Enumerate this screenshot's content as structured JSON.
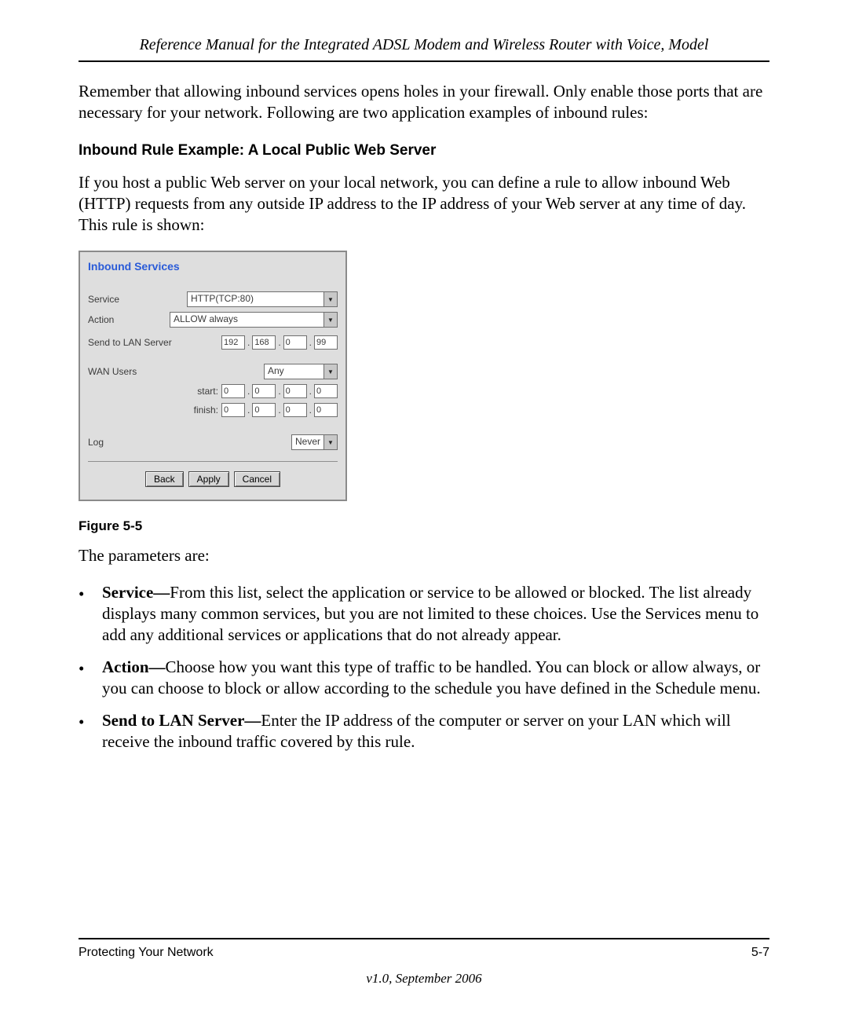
{
  "header": {
    "title": "Reference Manual for the Integrated ADSL Modem and Wireless Router with Voice, Model"
  },
  "intro": "Remember that allowing inbound services opens holes in your firewall. Only enable those ports that are necessary for your network. Following are two application examples of inbound rules:",
  "subhead": "Inbound Rule Example: A Local Public Web Server",
  "sub_intro": "If you host a public Web server on your local network, you can define a rule to allow inbound Web (HTTP) requests from any outside IP address to the IP address of your Web server at any time of day. This rule is shown:",
  "dialog": {
    "title": "Inbound Services",
    "service_label": "Service",
    "service_value": "HTTP(TCP:80)",
    "action_label": "Action",
    "action_value": "ALLOW always",
    "send_label": "Send to LAN Server",
    "send_ip": [
      "192",
      "168",
      "0",
      "99"
    ],
    "wan_label": "WAN Users",
    "wan_value": "Any",
    "start_label": "start:",
    "start_ip": [
      "0",
      "0",
      "0",
      "0"
    ],
    "finish_label": "finish:",
    "finish_ip": [
      "0",
      "0",
      "0",
      "0"
    ],
    "log_label": "Log",
    "log_value": "Never",
    "buttons": {
      "back": "Back",
      "apply": "Apply",
      "cancel": "Cancel"
    }
  },
  "figure_caption": "Figure 5-5",
  "parameters_intro": "The parameters are:",
  "parameters": [
    {
      "term": "Service—",
      "desc": "From this list, select the application or service to be allowed or blocked. The list already displays many common services, but you are not limited to these choices. Use the Services menu to add any additional services or applications that do not already appear."
    },
    {
      "term": "Action—",
      "desc": "Choose how you want this type of traffic to be handled. You can block or allow always, or you can choose to block or allow according to the schedule you have defined in the Schedule menu."
    },
    {
      "term": "Send to LAN Server—",
      "desc": "Enter the IP address of the computer or server on your LAN which will receive the inbound traffic covered by this rule."
    }
  ],
  "footer": {
    "left": "Protecting Your Network",
    "right": "5-7",
    "version": "v1.0, September 2006"
  }
}
